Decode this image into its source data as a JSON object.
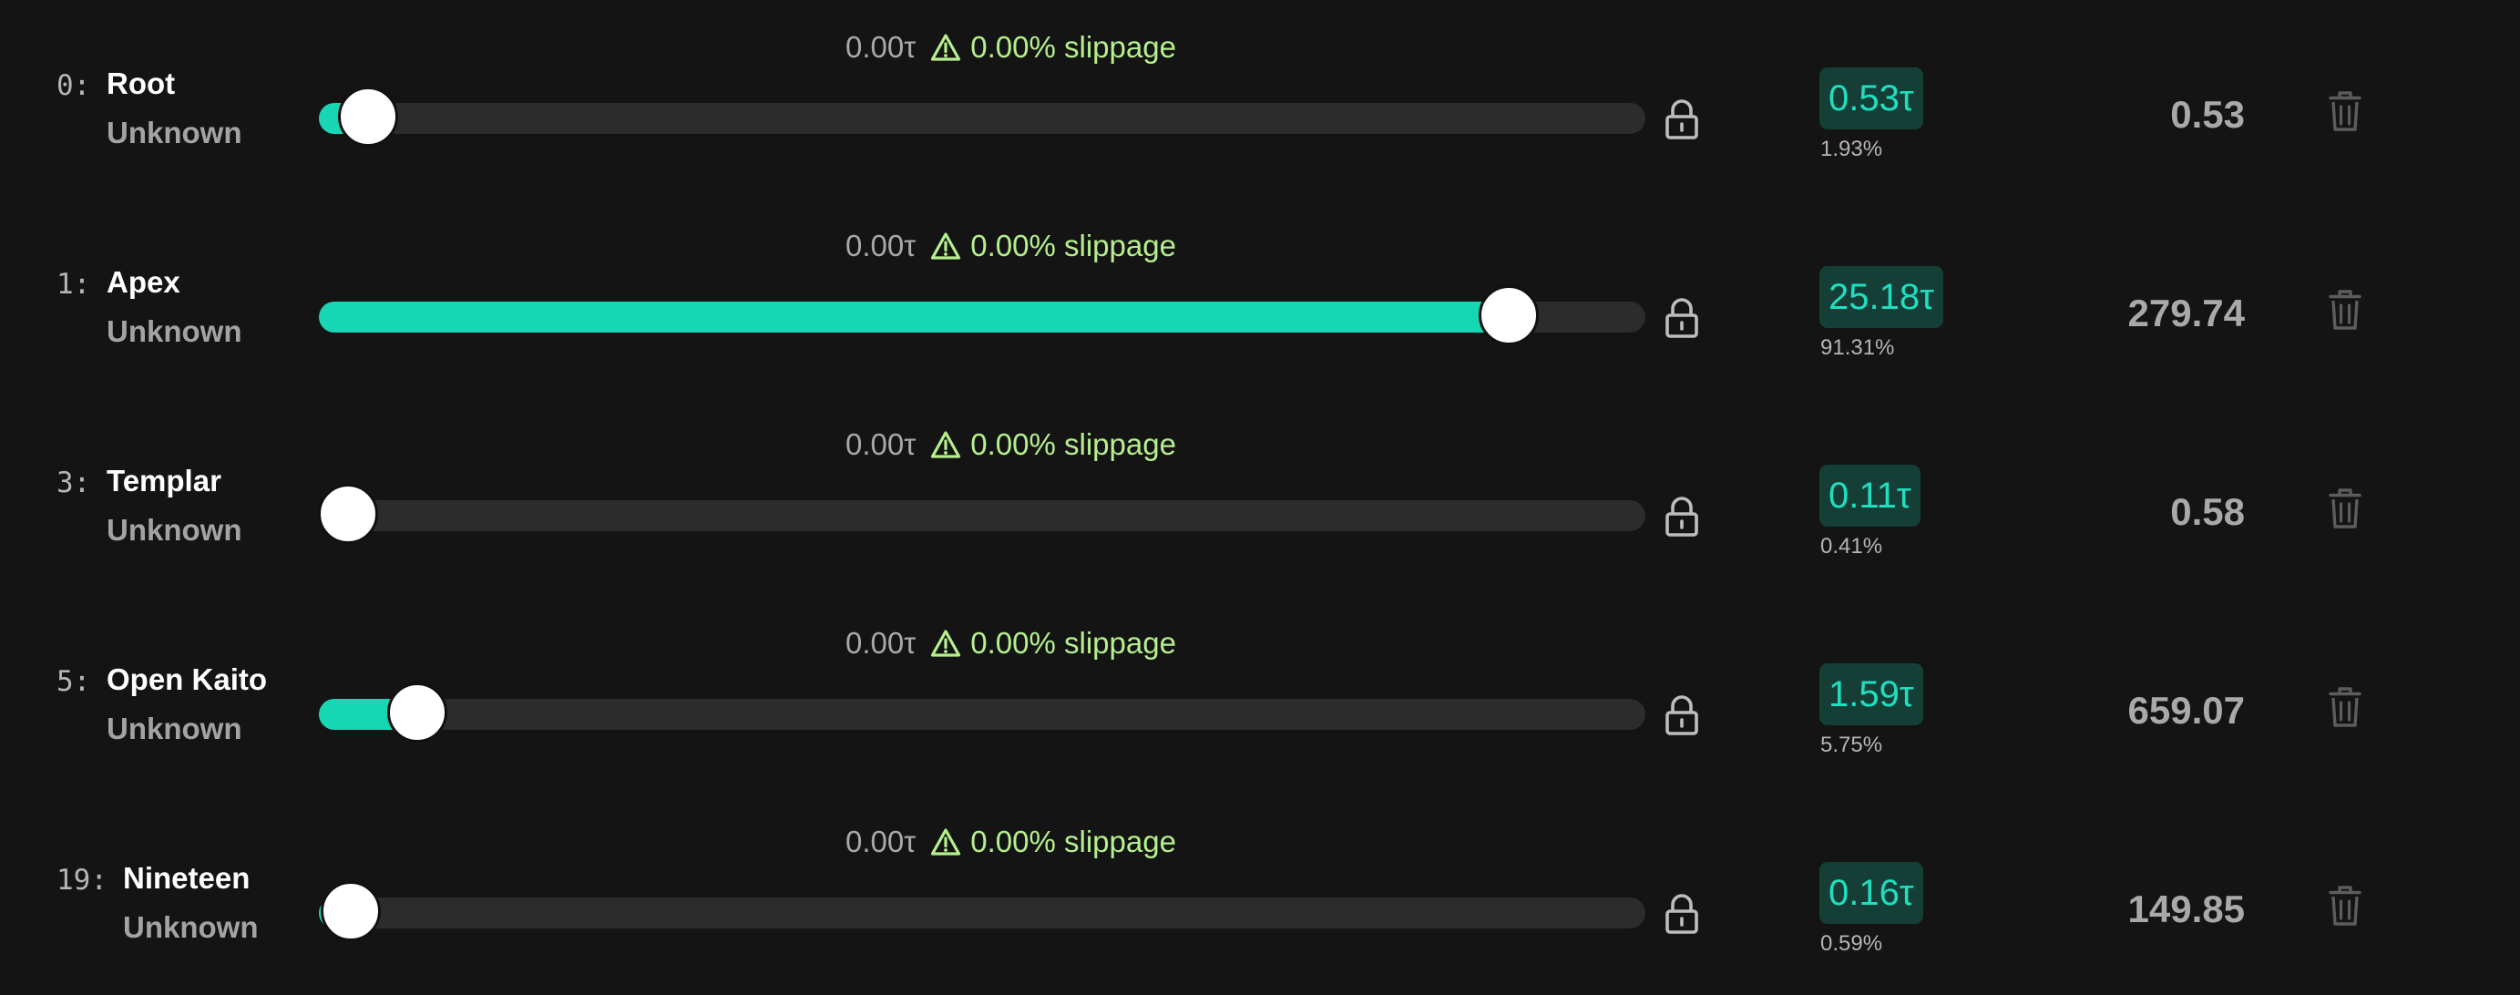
{
  "colors": {
    "background": "#141414",
    "accent": "#17d6b4",
    "track": "#2c2c2c",
    "slippage": "#b6ef8e",
    "badge_bg": "#153e37"
  },
  "rows": [
    {
      "index": "0:",
      "name": "Root",
      "status": "Unknown",
      "fee": "0.00τ",
      "slippage": "0.00% slippage",
      "stake": "0.53τ",
      "share": "1.93%",
      "amount": "0.53",
      "slider_fraction": 0.037
    },
    {
      "index": "1:",
      "name": "Apex",
      "status": "Unknown",
      "fee": "0.00τ",
      "slippage": "0.00% slippage",
      "stake": "25.18τ",
      "share": "91.31%",
      "amount": "279.74",
      "slider_fraction": 0.897
    },
    {
      "index": "3:",
      "name": "Templar",
      "status": "Unknown",
      "fee": "0.00τ",
      "slippage": "0.00% slippage",
      "stake": "0.11τ",
      "share": "0.41%",
      "amount": "0.58",
      "slider_fraction": 0.022
    },
    {
      "index": "5:",
      "name": "Open Kaito",
      "status": "Unknown",
      "fee": "0.00τ",
      "slippage": "0.00% slippage",
      "stake": "1.59τ",
      "share": "5.75%",
      "amount": "659.07",
      "slider_fraction": 0.074
    },
    {
      "index": "19:",
      "name": "Nineteen",
      "status": "Unknown",
      "fee": "0.00τ",
      "slippage": "0.00% slippage",
      "stake": "0.16τ",
      "share": "0.59%",
      "amount": "149.85",
      "slider_fraction": 0.024
    }
  ]
}
